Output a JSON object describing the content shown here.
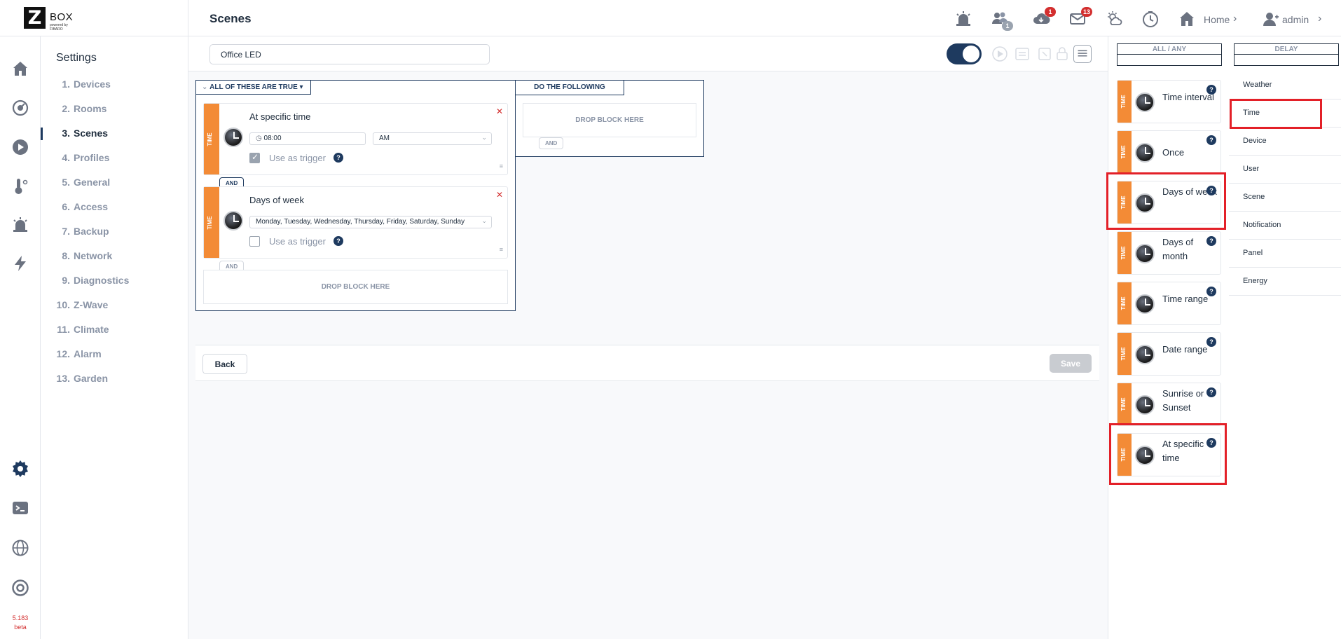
{
  "app": {
    "logo_letter": "Z",
    "logo_text": "BOX",
    "logo_sub": "powered by FIBARO",
    "page_title": "Scenes",
    "version": "5.183",
    "version_tag": "beta"
  },
  "header": {
    "badges": {
      "users": "1",
      "cloud": "1",
      "mail": "13"
    },
    "home_label": "Home",
    "user_label": "admin"
  },
  "settings": {
    "title": "Settings",
    "items": [
      {
        "num": "1.",
        "label": "Devices"
      },
      {
        "num": "2.",
        "label": "Rooms"
      },
      {
        "num": "3.",
        "label": "Scenes"
      },
      {
        "num": "4.",
        "label": "Profiles"
      },
      {
        "num": "5.",
        "label": "General"
      },
      {
        "num": "6.",
        "label": "Access"
      },
      {
        "num": "7.",
        "label": "Backup"
      },
      {
        "num": "8.",
        "label": "Network"
      },
      {
        "num": "9.",
        "label": "Diagnostics"
      },
      {
        "num": "10.",
        "label": "Z-Wave"
      },
      {
        "num": "11.",
        "label": "Climate"
      },
      {
        "num": "12.",
        "label": "Alarm"
      },
      {
        "num": "13.",
        "label": "Garden"
      }
    ],
    "active_index": 2
  },
  "scene": {
    "name": "Office LED",
    "enabled": true,
    "conditions_header": "ALL OF THESE ARE TRUE",
    "actions_header": "DO THE FOLLOWING",
    "drop_label": "DROP BLOCK HERE",
    "and_label": "AND",
    "strip_label": "TIME",
    "blocks": [
      {
        "title": "At specific time",
        "time_value": "08:00",
        "ampm_value": "AM",
        "trigger_label": "Use as trigger",
        "trigger_checked": true
      },
      {
        "title": "Days of week",
        "days_value": "Monday, Tuesday, Wednesday, Thursday, Friday, Saturday, Sunday",
        "trigger_label": "Use as trigger",
        "trigger_checked": false
      }
    ],
    "back_label": "Back",
    "save_label": "Save"
  },
  "palette": {
    "tabs": [
      "ALL / ANY",
      "DELAY"
    ],
    "cards": [
      {
        "label": "Time interval",
        "highlighted": false
      },
      {
        "label": "Once",
        "highlighted": false
      },
      {
        "label": "Days of week",
        "highlighted": true
      },
      {
        "label": "Days of month",
        "highlighted": false
      },
      {
        "label": "Time range",
        "highlighted": false
      },
      {
        "label": "Date range",
        "highlighted": false
      },
      {
        "label": "Sunrise or Sunset",
        "highlighted": false
      },
      {
        "label": "At specific time",
        "highlighted": true
      }
    ],
    "categories": [
      "Weather",
      "Time",
      "Device",
      "User",
      "Scene",
      "Notification",
      "Panel",
      "Energy"
    ],
    "active_category": "Time"
  },
  "colors": {
    "accent": "#1e3a5f",
    "block_strip": "#f38b36",
    "highlight": "#e32028",
    "badge": "#d32f2f"
  }
}
